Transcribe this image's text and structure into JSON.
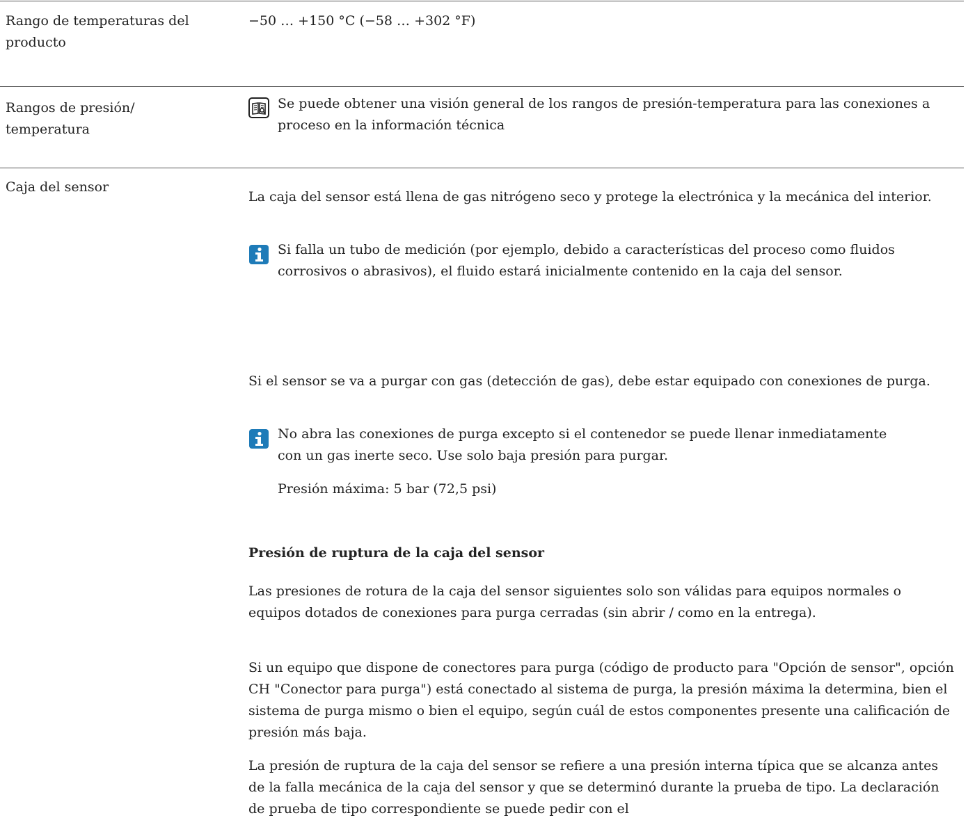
{
  "section_temp": {
    "label": "Rango de temperaturas del producto",
    "value": "−50 … +150 °C (−58 … +302 °F)"
  },
  "section_pressure": {
    "label": "Rangos de presión/ temperatura",
    "note": "Se puede obtener una visión general de los rangos de presión-temperatura para las conexiones a proceso en la información técnica",
    "icon": "book-icon"
  },
  "section_housing": {
    "label": "Caja del sensor",
    "para1": "La caja del sensor está llena de gas nitrógeno seco y protege la electrónica y la mecánica del interior.",
    "info1": "Si falla un tubo de medición (por ejemplo, debido a características del proceso como fluidos corrosivos o abrasivos), el fluido estará inicialmente contenido en la caja del sensor.",
    "para2": "Si el sensor se va a purgar con gas (detección de gas), debe estar equipado con conexiones de purga.",
    "info2": "No abra las conexiones de purga excepto si el contenedor se puede llenar inmediatamente con un gas inerte seco. Use solo baja presión para purgar.",
    "max_pressure": "Presión máxima: 5 bar (72,5 psi)",
    "subheading": "Presión de ruptura de la caja del sensor",
    "para3": "Las presiones de rotura de la caja del sensor siguientes solo son válidas para equipos normales o equipos dotados de conexiones para purga cerradas (sin abrir / como en la entrega).",
    "para4": "Si un equipo que dispone de conectores para purga (código de producto para \"Opción de sensor\", opción CH \"Conector para purga\") está conectado al sistema de purga, la presión máxima la determina, bien el sistema de purga mismo o bien el equipo, según cuál de estos componentes presente una calificación de presión más baja.",
    "para5": "La presión de ruptura de la caja del sensor se refiere a una presión interna típica que se alcanza antes de la falla mecánica de la caja del sensor y que se determinó durante la prueba de tipo. La declaración de prueba de tipo correspondiente se puede pedir con el"
  },
  "colors": {
    "info_icon": "#1e7bb8",
    "text": "#222222",
    "rule": "#555555"
  }
}
